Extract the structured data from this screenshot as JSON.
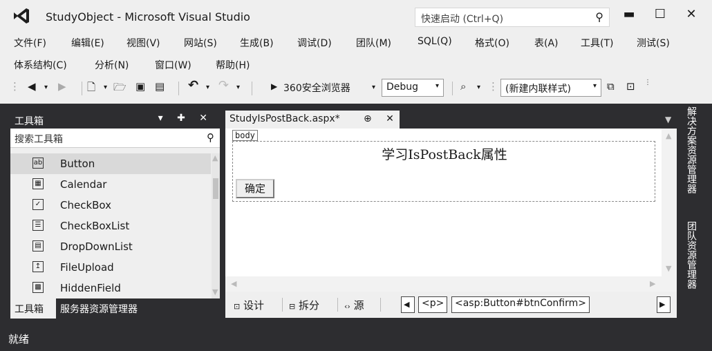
{
  "window": {
    "title": "StudyObject - Microsoft Visual Studio",
    "quick_launch_placeholder": "快速启动 (Ctrl+Q)",
    "minimize": "▬",
    "maximize": "☐",
    "close": "✕"
  },
  "menu": {
    "row1": [
      "文件(F)",
      "编辑(E)",
      "视图(V)",
      "网站(S)",
      "生成(B)",
      "调试(D)",
      "团队(M)",
      "SQL(Q)",
      "格式(O)",
      "表(A)",
      "工具(T)",
      "测试(S)"
    ],
    "row2": [
      "体系结构(C)",
      "分析(N)",
      "窗口(W)",
      "帮助(H)"
    ]
  },
  "toolbar": {
    "browser_label": "360安全浏览器",
    "config_value": "Debug",
    "style_value": "(新建内联样式)"
  },
  "toolbox": {
    "title": "工具箱",
    "header_controls": "▾ ✚ ✕",
    "search_placeholder": "搜索工具箱",
    "items": [
      {
        "label": "Button",
        "icon": "ab"
      },
      {
        "label": "Calendar",
        "icon": "▦"
      },
      {
        "label": "CheckBox",
        "icon": "✓"
      },
      {
        "label": "CheckBoxList",
        "icon": "☰"
      },
      {
        "label": "DropDownList",
        "icon": "▤"
      },
      {
        "label": "FileUpload",
        "icon": "↥"
      },
      {
        "label": "HiddenField",
        "icon": "▩"
      }
    ],
    "tab_toolbox": "工具箱",
    "tab_server": "服务器资源管理器"
  },
  "document": {
    "tab_label": "StudyIsPostBack.aspx*",
    "tab_controls": "⊕ ✕",
    "body_tag": "body",
    "heading": "学习IsPostBack属性",
    "button_label": "确定"
  },
  "viewbar": {
    "design": "设计",
    "split": "拆分",
    "source": "源",
    "path_p": "<p>",
    "path_button": "<asp:Button#btnConfirm>"
  },
  "side_panels": {
    "solution": "解决方案资源管理器",
    "team": "团队资源管理器"
  },
  "status": {
    "text": "就绪"
  }
}
